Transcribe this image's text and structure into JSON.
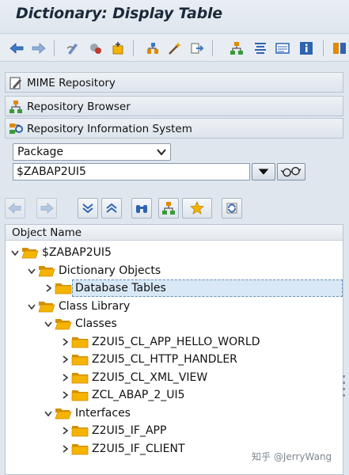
{
  "window": {
    "title": "Dictionary: Display Table"
  },
  "panels": [
    {
      "label": "MIME Repository",
      "icon": "pencil-doc-icon"
    },
    {
      "label": "Repository Browser",
      "icon": "hierarchy-icon"
    },
    {
      "label": "Repository Information System",
      "icon": "info-system-icon"
    }
  ],
  "selector": {
    "selected": "Package"
  },
  "package_input": {
    "value": "$ZABAP2UI5"
  },
  "tree": {
    "header": "Object Name",
    "nodes": [
      {
        "label": "$ZABAP2UI5",
        "level": 0,
        "expanded": true
      },
      {
        "label": "Dictionary Objects",
        "level": 1,
        "expanded": true
      },
      {
        "label": "Database Tables",
        "level": 2,
        "expanded": false,
        "selected": true
      },
      {
        "label": "Class Library",
        "level": 1,
        "expanded": true
      },
      {
        "label": "Classes",
        "level": 2,
        "expanded": true
      },
      {
        "label": "Z2UI5_CL_APP_HELLO_WORLD",
        "level": 3,
        "expanded": false
      },
      {
        "label": "Z2UI5_CL_HTTP_HANDLER",
        "level": 3,
        "expanded": false
      },
      {
        "label": "Z2UI5_CL_XML_VIEW",
        "level": 3,
        "expanded": false
      },
      {
        "label": "ZCL_ABAP_2_UI5",
        "level": 3,
        "expanded": false
      },
      {
        "label": "Interfaces",
        "level": 2,
        "expanded": true
      },
      {
        "label": "Z2UI5_IF_APP",
        "level": 3,
        "expanded": false
      },
      {
        "label": "Z2UI5_IF_CLIENT",
        "level": 3,
        "expanded": false
      }
    ]
  },
  "watermark": "知乎 @JerryWang",
  "colors": {
    "folder": "#f5b400",
    "folder_dark": "#d18f00",
    "selection": "#d8e8f6",
    "toolbar_blue": "#2f64b0"
  }
}
